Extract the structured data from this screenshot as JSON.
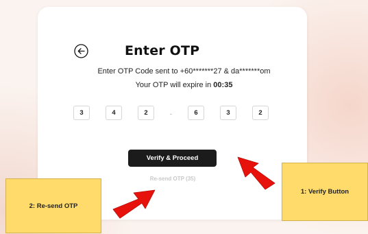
{
  "otp_card": {
    "back_icon": "arrow-left-circle-icon",
    "title": "Enter OTP",
    "sent_to": "Enter OTP Code sent to +60*******27 & da*******om",
    "expire_prefix": "Your OTP will expire in",
    "expire_time": "00:35",
    "digits": [
      "3",
      "4",
      "2",
      "6",
      "3",
      "2"
    ],
    "separator": "-",
    "verify_label": "Verify & Proceed",
    "resend_label": "Re-send OTP (35)"
  },
  "annotations": {
    "resend_note": "2: Re-send OTP",
    "verify_note": "1: Verify Button",
    "arrow_color": "#e8120c",
    "note_color": "#fedb6b"
  }
}
